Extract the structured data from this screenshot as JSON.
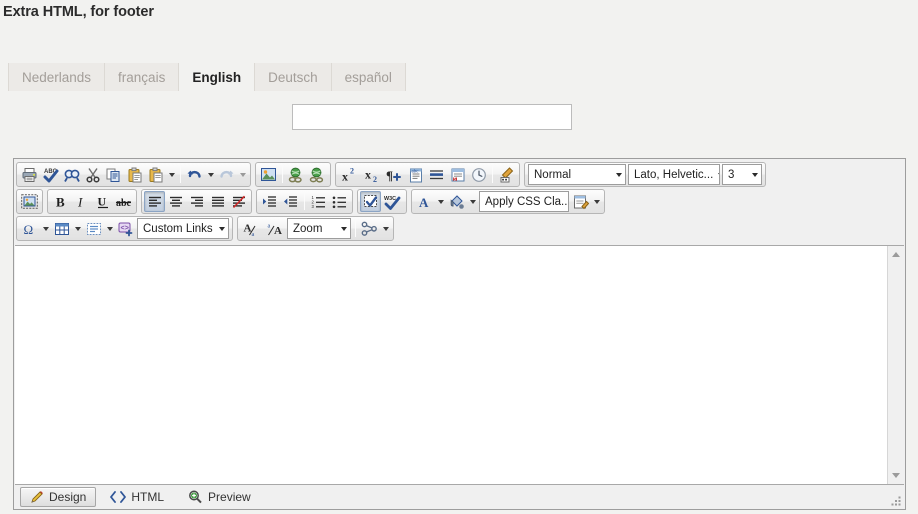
{
  "page": {
    "title": "Extra HTML, for footer"
  },
  "language_tabs": [
    {
      "label": "Nederlands",
      "active": false
    },
    {
      "label": "français",
      "active": false
    },
    {
      "label": "English",
      "active": true
    },
    {
      "label": "Deutsch",
      "active": false
    },
    {
      "label": "español",
      "active": false
    }
  ],
  "title_field": {
    "value": "",
    "placeholder": ""
  },
  "editor": {
    "toolbar_row1": {
      "group1": [
        "print-icon",
        "spellcheck-icon",
        "find-icon",
        "cut-icon",
        "copy-icon",
        "paste-icon",
        "paste-options-icon"
      ],
      "group1_undo": [
        "undo-icon",
        "redo-icon"
      ],
      "group2": [
        "image-manager-icon",
        "hyperlink-icon",
        "unlink-icon"
      ],
      "group3": [
        "superscript-icon",
        "subscript-icon",
        "paragraph-insert-icon",
        "document-manager-icon",
        "horizontal-rule-icon",
        "flash-manager-icon",
        "date-time-icon",
        "format-painter-icon"
      ],
      "paragraph_style": "Normal",
      "font_name": "Lato, Helvetic...",
      "font_size": "3"
    },
    "toolbar_row2": {
      "group1": [
        "image-with-border-icon"
      ],
      "group2": [
        "bold-icon",
        "italic-icon",
        "underline-icon",
        "strikethrough-icon"
      ],
      "group3": [
        "align-left-icon",
        "align-center-icon",
        "align-right-icon",
        "align-justify-icon",
        "remove-format-icon"
      ],
      "group4": [
        "indent-icon",
        "outdent-icon"
      ],
      "group5": [
        "numbered-list-icon",
        "bulleted-list-icon"
      ],
      "group6": [
        "show-blocks-icon",
        "w3c-validate-icon"
      ],
      "group7": [
        "fore-color-icon",
        "back-color-icon"
      ],
      "css_class": "Apply CSS Cla..",
      "group8": [
        "style-builder-icon"
      ],
      "pressed": [
        "align-left-icon",
        "show-blocks-icon"
      ]
    },
    "toolbar_row3": {
      "group1": [
        "special-character-icon",
        "table-icon",
        "form-element-icon",
        "insert-code-icon"
      ],
      "custom_links": "Custom Links",
      "group2": [
        "decrease-font-size-icon",
        "increase-font-size-icon"
      ],
      "zoom": "Zoom",
      "group3": [
        "module-manager-icon"
      ]
    },
    "content": {
      "html": ""
    },
    "mode_tabs": [
      {
        "label": "Design",
        "icon": "pencil-icon",
        "active": true
      },
      {
        "label": "HTML",
        "icon": "code-icon",
        "active": false
      },
      {
        "label": "Preview",
        "icon": "preview-icon",
        "active": false
      }
    ],
    "scrollbar": {
      "up_icon": "scroll-up-icon",
      "down_icon": "scroll-down-icon"
    },
    "resize_grip_icon": "resize-grip-icon"
  },
  "colors": {
    "page_background": "#f2f2f0",
    "toolbar_background": "#f0f0f0",
    "content_background": "#ffffff",
    "active_tab_text": "#232323",
    "inactive_tab_text": "#a39e99",
    "icon_blue": "#2f5597",
    "icon_gold": "#e8b84b",
    "icon_green": "#3f9a3f"
  }
}
